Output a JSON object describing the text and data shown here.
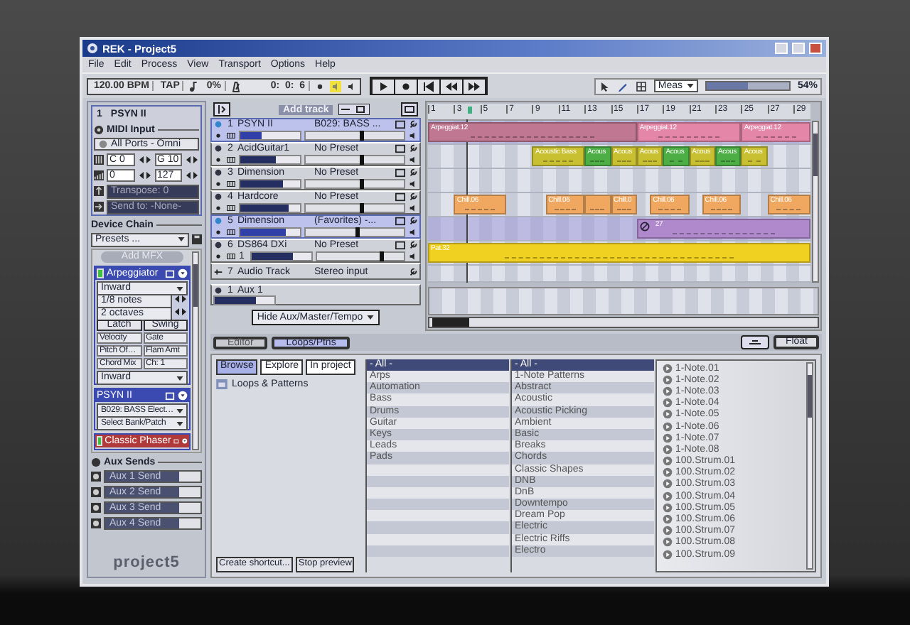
{
  "window": {
    "title": "REK - Project5"
  },
  "menu": [
    "File",
    "Edit",
    "Process",
    "View",
    "Transport",
    "Options",
    "Help"
  ],
  "toolbar": {
    "tempo": "120.00 BPM",
    "tap": "TAP",
    "swing": "0%",
    "position": "0:  0:  6",
    "zoom": {
      "mode": "Meas",
      "level": 0.5,
      "reading": "54%"
    }
  },
  "inspector": {
    "number": "1",
    "name": "PSYN II",
    "midi_input": {
      "title": "MIDI Input",
      "port": "All Ports - Omni",
      "key_low": "C 0",
      "key_high": "G 10",
      "vel_low": "0",
      "vel_high": "127",
      "transpose": "Transpose: 0",
      "send_to": "Send to: -None-"
    },
    "device_chain": {
      "title": "Device Chain",
      "presets": "Presets ...",
      "add_button": "Add MFX",
      "devices": [
        {
          "kind": "arpeggiator",
          "name": "Arpeggiator",
          "enabled": true,
          "controls": [
            {
              "kind": "dropdown",
              "label": "Inward"
            },
            {
              "kind": "stepper",
              "label": "1/8 notes"
            },
            {
              "kind": "stepper",
              "label": "2 octaves"
            },
            {
              "kind": "buttons",
              "items": [
                "Latch",
                "Swing"
              ]
            },
            {
              "kind": "pair",
              "items": [
                "Velocity",
                "Gate"
              ]
            },
            {
              "kind": "pair",
              "items": [
                "Pitch Of…",
                "Flam Amt"
              ]
            },
            {
              "kind": "pair",
              "items": [
                "Chord Mix",
                "Ch: 1"
              ]
            },
            {
              "kind": "dropdown",
              "label": "Inward"
            }
          ]
        },
        {
          "kind": "synth",
          "name": "PSYN II",
          "patch": "B029: BASS Elect…",
          "bank": "Select Bank/Patch"
        },
        {
          "kind": "effect",
          "name": "Classic Phaser",
          "enabled": true
        }
      ]
    },
    "aux_sends": {
      "title": "Aux Sends",
      "sends": [
        {
          "label": "Aux 1 Send",
          "level": 0.78
        },
        {
          "label": "Aux 2 Send",
          "level": 0.78
        },
        {
          "label": "Aux 3 Send",
          "level": 0.78
        },
        {
          "label": "Aux 4 Send",
          "level": 0.78
        }
      ]
    },
    "logo": "project5"
  },
  "add_track": "Add track",
  "ruler": [
    "1",
    "3",
    "5",
    "7",
    "9",
    "11",
    "13",
    "15",
    "17",
    "19",
    "21",
    "23",
    "25",
    "27",
    "29"
  ],
  "tracks": [
    {
      "kind": "instrument",
      "number": "1",
      "name": "PSYN II",
      "preset": "B029: BASS ...",
      "selected": true,
      "level": 0.35,
      "volume": {
        "level": 0.55
      },
      "clips": [
        {
          "label": "Arpeggiat.12",
          "color": "#c07892",
          "muted": false
        },
        {
          "label": "Arpeggiat.12",
          "color": "#e486a8",
          "muted": false
        },
        {
          "label": "Arpeggiat.12",
          "color": "#e486a8",
          "muted": false
        }
      ]
    },
    {
      "kind": "instrument",
      "number": "2",
      "name": "AcidGuitar1",
      "preset": "No Preset",
      "selected": false,
      "level": 0.6,
      "volume": {
        "level": 0.55
      },
      "clips": [
        {
          "label": "Acoustic Bass",
          "color": "#c8c030",
          "muted": false
        },
        {
          "label": "Acous",
          "color": "#4cae44",
          "muted": false
        },
        {
          "label": "Acous",
          "color": "#c8c030",
          "muted": false
        },
        {
          "label": "Acous",
          "color": "#c8c030",
          "muted": false
        },
        {
          "label": "Acous",
          "color": "#4cae44",
          "muted": false
        },
        {
          "label": "Acous",
          "color": "#c8c030",
          "muted": false
        },
        {
          "label": "Acous",
          "color": "#4cae44",
          "muted": false
        },
        {
          "label": "Acous",
          "color": "#c8c030",
          "muted": false
        }
      ]
    },
    {
      "kind": "instrument",
      "number": "3",
      "name": "Dimension",
      "preset": "No Preset",
      "selected": false,
      "level": 0.72,
      "volume": {
        "level": 0.55
      }
    },
    {
      "kind": "instrument",
      "number": "4",
      "name": "Hardcore",
      "preset": "No Preset",
      "selected": false,
      "level": 0.8,
      "volume": {
        "level": 0.55
      },
      "clips": [
        {
          "label": "Chill.06",
          "color": "#f0a860",
          "muted": false
        },
        {
          "label": "Chill.06",
          "color": "#f0a860",
          "muted": false
        },
        {
          "color": "#f0a860",
          "muted": false
        },
        {
          "label": "Chill.0",
          "color": "#f0a860",
          "muted": false
        },
        {
          "label": "Chill.06",
          "color": "#f0a860",
          "muted": false
        },
        {
          "label": "Chill.06",
          "color": "#f0a860",
          "muted": false
        },
        {
          "label": "Chill.06",
          "color": "#f0a860",
          "muted": false
        }
      ]
    },
    {
      "kind": "instrument",
      "number": "5",
      "name": "Dimension",
      "preset": "(Favorites) -...",
      "selected": true,
      "level": 0.75,
      "volume": {
        "level": 0.5
      },
      "clips": [
        {
          "label": "27",
          "color": "#b088cc",
          "muted": true
        }
      ]
    },
    {
      "kind": "instrument",
      "number": "6",
      "name": "DS864 DXi",
      "preset": "No Preset",
      "selected": false,
      "output": "1",
      "level": 0.7,
      "volume": {
        "level": 0.72
      },
      "clips": [
        {
          "label": "Pat.32",
          "color": "#f0d020",
          "muted": false
        }
      ]
    },
    {
      "kind": "audio",
      "number": "7",
      "name": "Audio Track",
      "preset": "Stereo input",
      "selected": false
    }
  ],
  "aux_track": {
    "number": "1",
    "name": "Aux 1",
    "level": 0.7
  },
  "track_filter": "Hide Aux/Master/Tempo",
  "bottom_tabs": [
    {
      "label": "Editor",
      "selected": false
    },
    {
      "label": "Loops/Ptns",
      "selected": true
    }
  ],
  "float_button": "Float",
  "browser": {
    "modes": [
      {
        "label": "Browse",
        "selected": true
      },
      {
        "label": "Explore",
        "selected": false
      },
      {
        "label": "In project",
        "selected": false
      }
    ],
    "tree": [
      "Loops & Patterns"
    ],
    "buttons": [
      "Create shortcut...",
      "Stop preview"
    ],
    "columns": [
      {
        "header": "- All -",
        "items": [
          "Arps",
          "Automation",
          "Bass",
          "Drums",
          "Guitar",
          "Keys",
          "Leads",
          "Pads"
        ]
      },
      {
        "header": "- All -",
        "items": [
          "1-Note Patterns",
          "Abstract",
          "Acoustic",
          "Acoustic Picking",
          "Ambient",
          "Basic",
          "Breaks",
          "Chords",
          "Classic Shapes",
          "DNB",
          "DnB",
          "Downtempo",
          "Dream Pop",
          "Electric",
          "Electric Riffs",
          "Electro"
        ]
      }
    ],
    "files": [
      "1-Note.01",
      "1-Note.02",
      "1-Note.03",
      "1-Note.04",
      "1-Note.05",
      "1-Note.06",
      "1-Note.07",
      "1-Note.08",
      "100.Strum.01",
      "100.Strum.02",
      "100.Strum.03",
      "100.Strum.04",
      "100.Strum.05",
      "100.Strum.06",
      "100.Strum.07",
      "100.Strum.08",
      "100.Strum.09"
    ]
  }
}
